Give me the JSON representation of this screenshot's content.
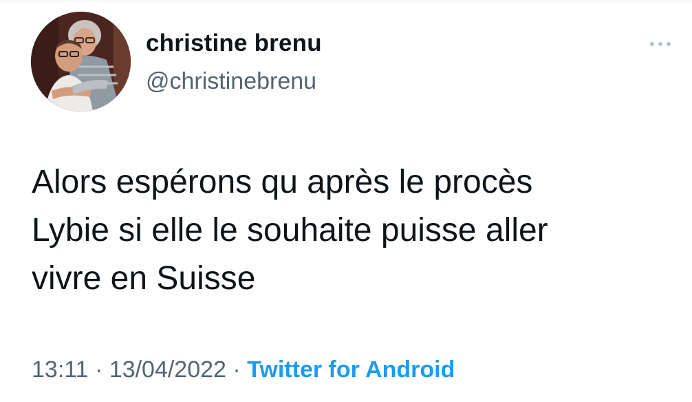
{
  "author": {
    "display_name": "christine brenu",
    "handle": "@christinebrenu",
    "avatar_icon": "profile-photo"
  },
  "menu": {
    "icon": "more-options-icon"
  },
  "tweet": {
    "lines": [
      "Alors espérons qu après le procès",
      "Lybie si elle le souhaite puisse aller",
      "vivre en Suisse"
    ]
  },
  "meta": {
    "time": "13:11",
    "separator_1": " · ",
    "date": "13/04/2022",
    "separator_2": " · ",
    "source": "Twitter for Android"
  },
  "colors": {
    "text": "#0f1419",
    "secondary": "#536471",
    "link": "#1d9bf0"
  }
}
